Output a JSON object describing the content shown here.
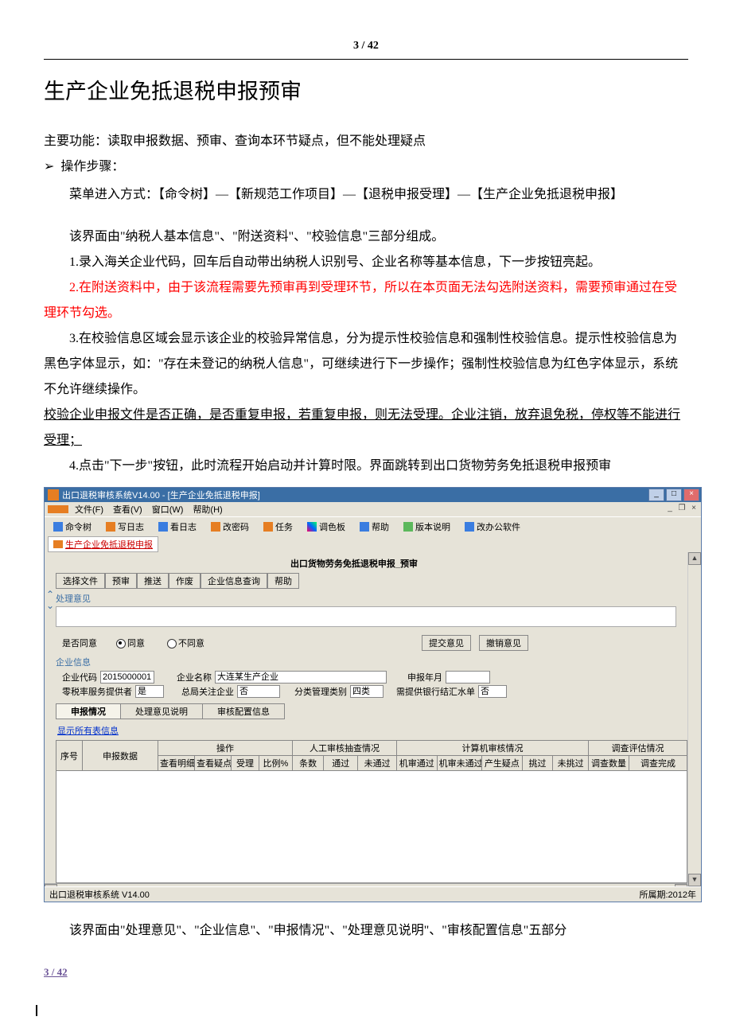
{
  "page_top": "3 / 42",
  "h1": "生产企业免抵退税申报预审",
  "intro": "主要功能：读取申报数据、预审、查询本环节疑点，但不能处理疑点",
  "steps_label": "操作步骤：",
  "menu_path": "菜单进入方式：【命令树】—【新规范工作项目】—【退税申报受理】—【生产企业免抵退税申报】",
  "para1": "该界面由\"纳税人基本信息\"、\"附送资料\"、\"校验信息\"三部分组成。",
  "para2": "1.录入海关企业代码，回车后自动带出纳税人识别号、企业名称等基本信息，下一步按钮亮起。",
  "para3_red": "2.在附送资料中，由于该流程需要先预审再到受理环节，所以在本页面无法勾选附送资料，需要预审通过在受理环节勾选。",
  "para4": "3.在校验信息区域会显示该企业的校验异常信息，分为提示性校验信息和强制性校验信息。提示性校验信息为黑色字体显示，如：\"存在未登记的纳税人信息\"，可继续进行下一步操作；强制性校验信息为红色字体显示，系统不允许继续操作。",
  "para5_u": "校验企业申报文件是否正确，是否重复申报，若重复申报，则无法受理。企业注销，放弃退免税，停权等不能进行受理；",
  "para6": "4.点击\"下一步\"按钮，此时流程开始启动并计算时限。界面跳转到出口货物劳务免抵退税申报预审",
  "app": {
    "title": "出口退税审核系统V14.00    -  [生产企业免抵退税申报]",
    "menus": [
      "文件(F)",
      "查看(V)",
      "窗口(W)",
      "帮助(H)"
    ],
    "toolbar": [
      "命令树",
      "写日志",
      "看日志",
      "改密码",
      "任务",
      "调色板",
      "帮助",
      "版本说明",
      "改办公软件"
    ],
    "tab": "生产企业免抵退税申报",
    "work_title": "出口货物劳务免抵退税申报_预审",
    "work_btns": [
      "选择文件",
      "预审",
      "推送",
      "作废",
      "企业信息查询",
      "帮助"
    ],
    "sec_opinion": "处理意见",
    "agree_label": "是否同意",
    "agree": "同意",
    "disagree": "不同意",
    "btn_submit": "提交意见",
    "btn_withdraw": "撤销意见",
    "sec_ent": "企业信息",
    "f_code_l": "企业代码",
    "f_code_v": "2015000001",
    "f_name_l": "企业名称",
    "f_name_v": "大连某生产企业",
    "f_period_l": "申报年月",
    "f_zero_l": "零税率服务提供者",
    "f_zero_v": "是",
    "f_hq_l": "总局关注企业",
    "f_hq_v": "否",
    "f_cls_l": "分类管理类别",
    "f_cls_v": "四类",
    "f_bank_l": "需提供银行结汇水单",
    "f_bank_v": "否",
    "tabs": [
      "申报情况",
      "处理意见说明",
      "审核配置信息"
    ],
    "link_all": "显示所有表信息",
    "grid": {
      "c1": "序号",
      "c2": "申报数据",
      "g1": "操作",
      "g1s": [
        "查看明细",
        "查看疑点",
        "受理",
        "比例%"
      ],
      "g2": "人工审核抽查情况",
      "g2s": [
        "条数",
        "通过",
        "未通过"
      ],
      "g3": "计算机审核情况",
      "g3s": [
        "机审通过",
        "机审未通过",
        "产生疑点",
        "挑过",
        "未挑过"
      ],
      "g4": "调查评估情况",
      "g4s": [
        "调查数量",
        "调查完成"
      ]
    },
    "status_l": "出口退税审核系统 V14.00",
    "status_r": "所属期:2012年"
  },
  "tail": "该界面由\"处理意见\"、\"企业信息\"、\"申报情况\"、\"处理意见说明\"、\"审核配置信息\"五部分",
  "page_bottom": "3 / 42"
}
